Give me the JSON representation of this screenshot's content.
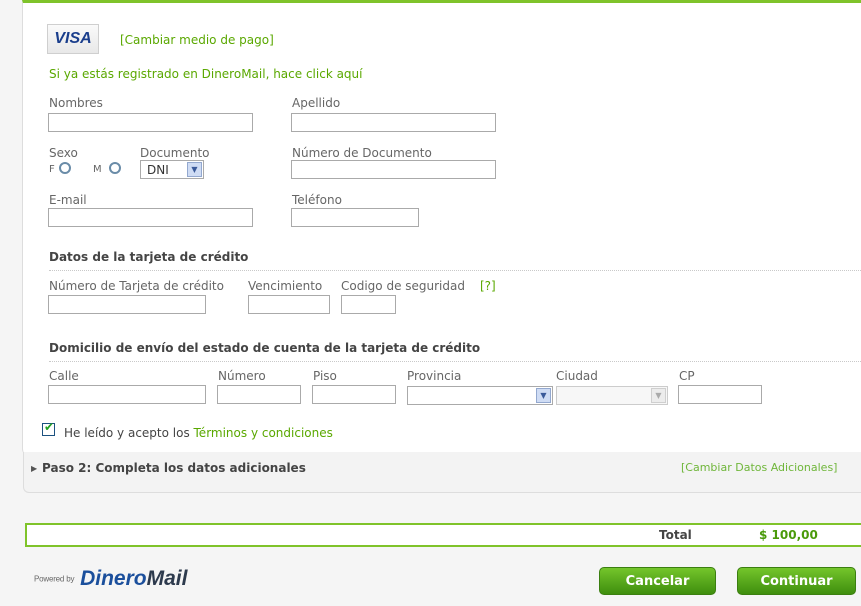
{
  "payment": {
    "card_logo": "VISA",
    "change_method_link": "[Cambiar medio de pago]",
    "registered_link": "Si ya estás registrado en DineroMail, hace click aquí"
  },
  "form": {
    "nombres_label": "Nombres",
    "apellido_label": "Apellido",
    "sexo_label": "Sexo",
    "sexo_f": "F",
    "sexo_m": "M",
    "documento_label": "Documento",
    "documento_value": "DNI",
    "numero_documento_label": "Número de Documento",
    "email_label": "E-mail",
    "telefono_label": "Teléfono"
  },
  "card_section": {
    "title": "Datos de la tarjeta de crédito",
    "numero_label": "Número de Tarjeta de crédito",
    "vencimiento_label": "Vencimiento",
    "codigo_label": "Codigo de seguridad",
    "help_link": "[?]"
  },
  "address_section": {
    "title": "Domicilio de envío del estado de cuenta de la tarjeta de crédito",
    "calle_label": "Calle",
    "numero_label": "Número",
    "piso_label": "Piso",
    "provincia_label": "Provincia",
    "ciudad_label": "Ciudad",
    "cp_label": "CP"
  },
  "terms": {
    "prefix": "He leído y acepto los ",
    "link": "Términos y condiciones",
    "checked": true
  },
  "step2": {
    "title": "Paso 2: Completa los datos adicionales",
    "change_link": "[Cambiar Datos Adicionales]"
  },
  "total": {
    "label": "Total",
    "amount": "$ 100,00"
  },
  "footer": {
    "powered_by": "Powered by",
    "brand_part1": "Dinero",
    "brand_part2": "Mail",
    "cancel_label": "Cancelar",
    "continue_label": "Continuar"
  },
  "colors": {
    "accent_green": "#7fc32a",
    "link_green": "#5aa800",
    "brand_blue": "#1b4f9c"
  }
}
